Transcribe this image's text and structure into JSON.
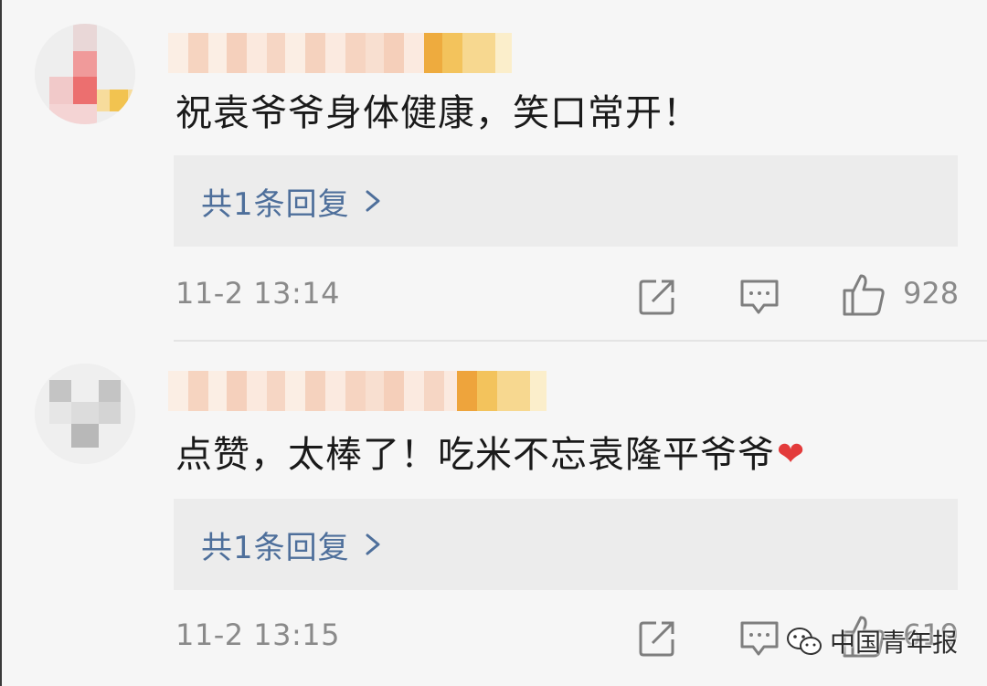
{
  "comments": [
    {
      "text": "祝袁爷爷身体健康，笑口常开！",
      "reply_label": "共1条回复",
      "timestamp": "11-2 13:14",
      "like_count": "928"
    },
    {
      "text": "点赞，太棒了！吃米不忘袁隆平爷爷",
      "reply_label": "共1条回复",
      "timestamp": "11-2 13:15",
      "like_count": "619"
    }
  ],
  "icons": {
    "share": "share-icon",
    "comment": "comment-icon",
    "like": "thumbs-up-icon",
    "reply_arrow": "chevron-right-icon",
    "heart": "heart-emoji-icon"
  },
  "watermark": {
    "label": "中国青年报"
  },
  "colors": {
    "link_blue": "#4e6f9b",
    "meta_gray": "#8a8a8a",
    "reply_bg": "#ececec",
    "page_bg": "#f6f6f6",
    "heart_red": "#e33b3b"
  }
}
